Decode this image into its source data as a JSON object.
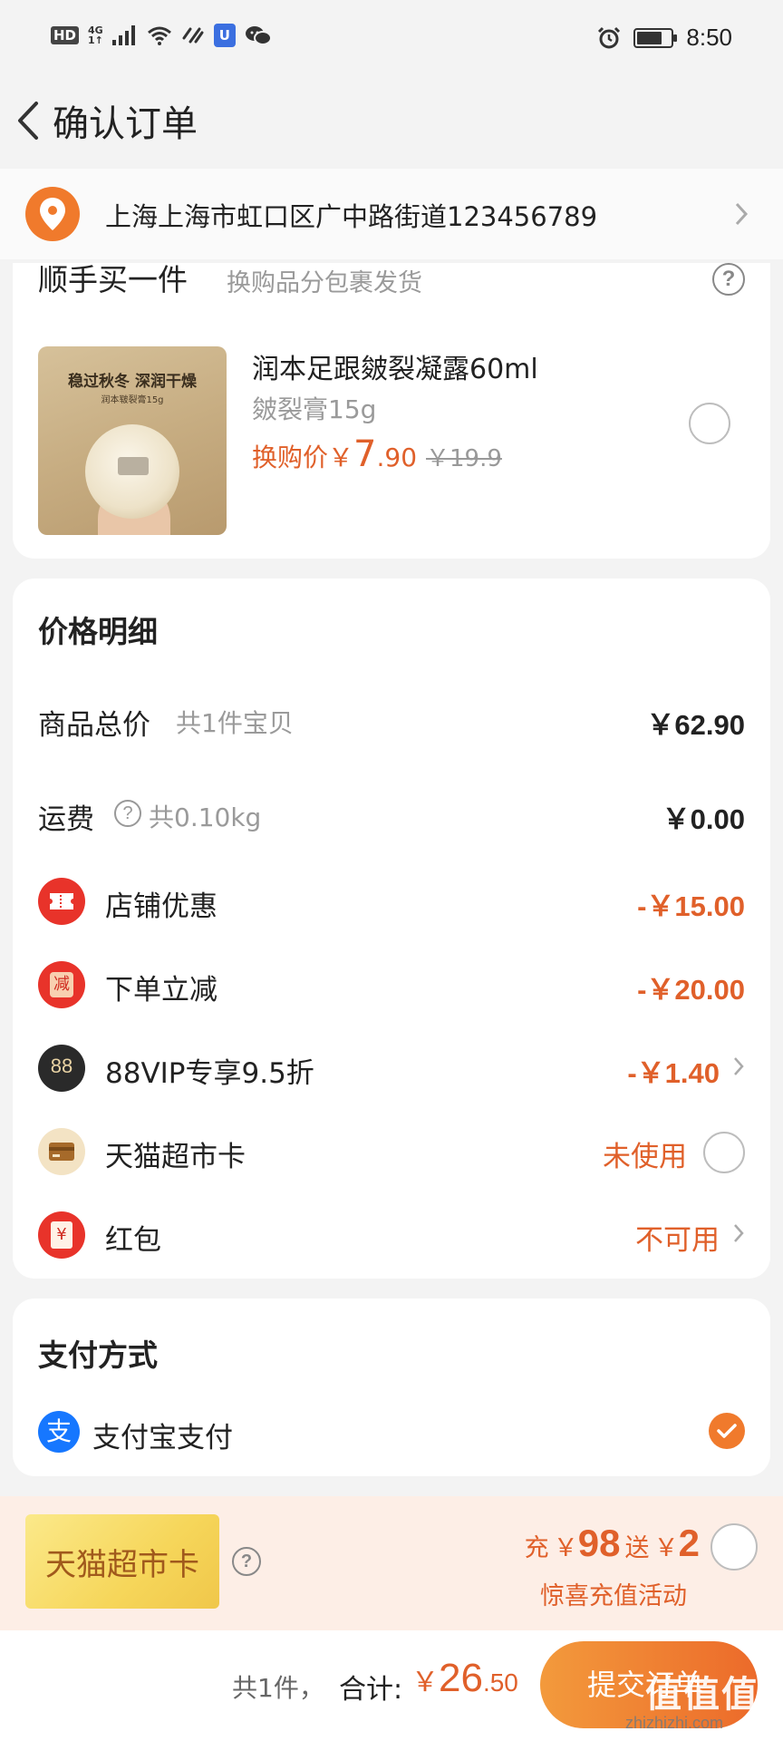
{
  "status_bar": {
    "hd": "HD",
    "network": "4G",
    "network_sub": "1↑",
    "time": "8:50",
    "battery_level": 0.75
  },
  "header": {
    "title": "确认订单"
  },
  "address": {
    "text": "上海上海市虹口区广中路街道123456789"
  },
  "addon": {
    "title": "顺手买一件",
    "subtitle": "换购品分包裹发货",
    "help": "?",
    "product": {
      "image_headline": "稳过秋冬 深润干燥",
      "image_caption": "润本皲裂膏15g",
      "name": "润本足跟皴裂凝露60ml",
      "spec": "皴裂膏15g",
      "price_label": "换购价",
      "price_yen": "￥",
      "price_int": "7",
      "price_dec": ".90",
      "old_price": "￥19.9"
    }
  },
  "price_detail": {
    "title": "价格明细",
    "rows": {
      "total": {
        "label": "商品总价",
        "sub": "共1件宝贝",
        "value": "￥62.90"
      },
      "shipping": {
        "label": "运费",
        "help": "?",
        "sub": "共0.10kg",
        "value": "￥0.00"
      },
      "store_discount": {
        "label": "店铺优惠",
        "value": "-￥15.00"
      },
      "order_discount": {
        "label": "下单立减",
        "icon_text": "减",
        "value": "-￥20.00"
      },
      "vip": {
        "label": "88VIP专享9.5折",
        "icon_text": "88",
        "value": "-￥1.40"
      },
      "market_card": {
        "label": "天猫超市卡",
        "value": "未使用"
      },
      "red_packet": {
        "label": "红包",
        "icon_text": "¥",
        "value": "不可用"
      }
    }
  },
  "payment": {
    "title": "支付方式",
    "method_icon": "支",
    "method": "支付宝支付"
  },
  "promo": {
    "card_label": "天猫超市卡",
    "help": "?",
    "charge_label": "充",
    "charge_yen": "￥",
    "charge_amount": "98",
    "gift_label": "送",
    "gift_yen": "￥",
    "gift_amount": "2",
    "subtitle": "惊喜充值活动"
  },
  "footer": {
    "count": "共1件，",
    "total_label": "合计:",
    "total_yen": "￥",
    "total_int": "26",
    "total_dec": ".50",
    "submit": "提交订单"
  },
  "watermark": {
    "text": "值值值",
    "url": "zhizhizhi.com"
  },
  "colors": {
    "accent": "#e0602a",
    "orange_icon": "#f07a2c",
    "red_icon": "#e8332a",
    "alipay": "#1677ff",
    "background": "#f3f3f3"
  }
}
